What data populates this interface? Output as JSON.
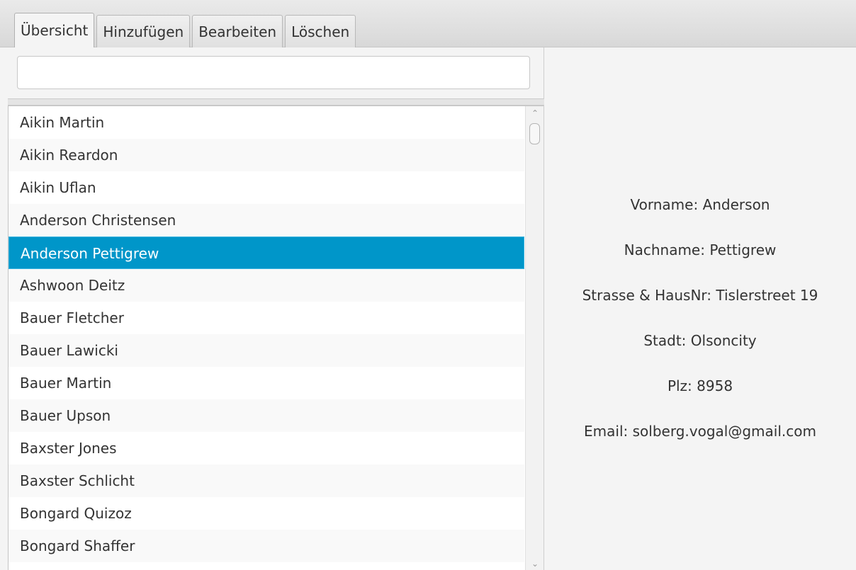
{
  "tabs": [
    {
      "label": "Übersicht",
      "selected": true
    },
    {
      "label": "Hinzufügen",
      "selected": false
    },
    {
      "label": "Bearbeiten",
      "selected": false
    },
    {
      "label": "Löschen",
      "selected": false
    }
  ],
  "search": {
    "value": "",
    "placeholder": ""
  },
  "list": {
    "selected_index": 4,
    "items": [
      "Aikin Martin",
      "Aikin Reardon",
      "Aikin Uflan",
      "Anderson Christensen",
      "Anderson Pettigrew",
      "Ashwoon Deitz",
      "Bauer Fletcher",
      "Bauer Lawicki",
      "Bauer Martin",
      "Bauer Upson",
      "Baxster Jones",
      "Baxster Schlicht",
      "Bongard Quizoz",
      "Bongard Shaffer"
    ]
  },
  "scrollbar": {
    "up_icon": "chevron-up-icon",
    "down_icon": "chevron-down-icon"
  },
  "detail": {
    "vorname": "Vorname:  Anderson",
    "nachname": "Nachname:  Pettigrew",
    "strasse": "Strasse & HausNr:  Tislerstreet 19",
    "stadt": "Stadt:  Olsoncity",
    "plz": "Plz:  8958",
    "email": "Email:  solberg.vogal@gmail.com"
  },
  "colors": {
    "selection": "#0096c9",
    "background": "#f4f4f4",
    "text": "#333333"
  }
}
